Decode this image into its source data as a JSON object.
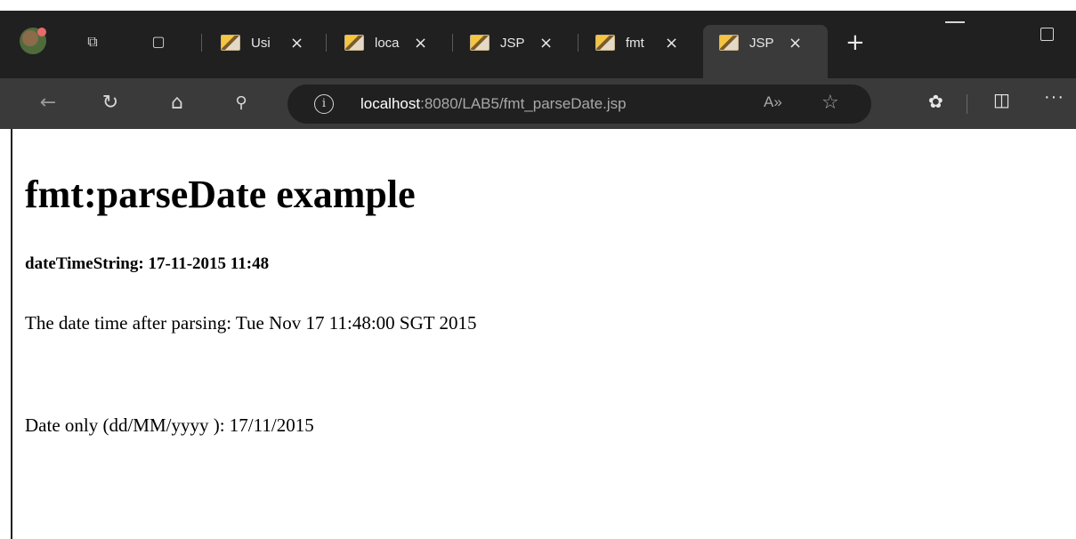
{
  "browser": {
    "tabs": [
      {
        "title": "Usi",
        "active": false
      },
      {
        "title": "loca",
        "active": false
      },
      {
        "title": "JSP",
        "active": false
      },
      {
        "title": "fmt",
        "active": false
      },
      {
        "title": "JSP",
        "active": true
      }
    ],
    "close_glyph": "×",
    "newtab_glyph": "+",
    "address": {
      "host": "localhost",
      "path": ":8080/LAB5/fmt_parseDate.jsp"
    },
    "read_aloud_glyph": "A»"
  },
  "page": {
    "heading": "fmt:parseDate example",
    "datetime_line": "dateTimeString: 17-11-2015 11:48",
    "parsed_line": "The date time after parsing: Tue Nov 17 11:48:00 SGT 2015",
    "date_only_line": "Date only (dd/MM/yyyy ): 17/11/2015"
  },
  "colors": {
    "chrome_dark": "#202020",
    "toolbar": "#3a3a3a"
  }
}
